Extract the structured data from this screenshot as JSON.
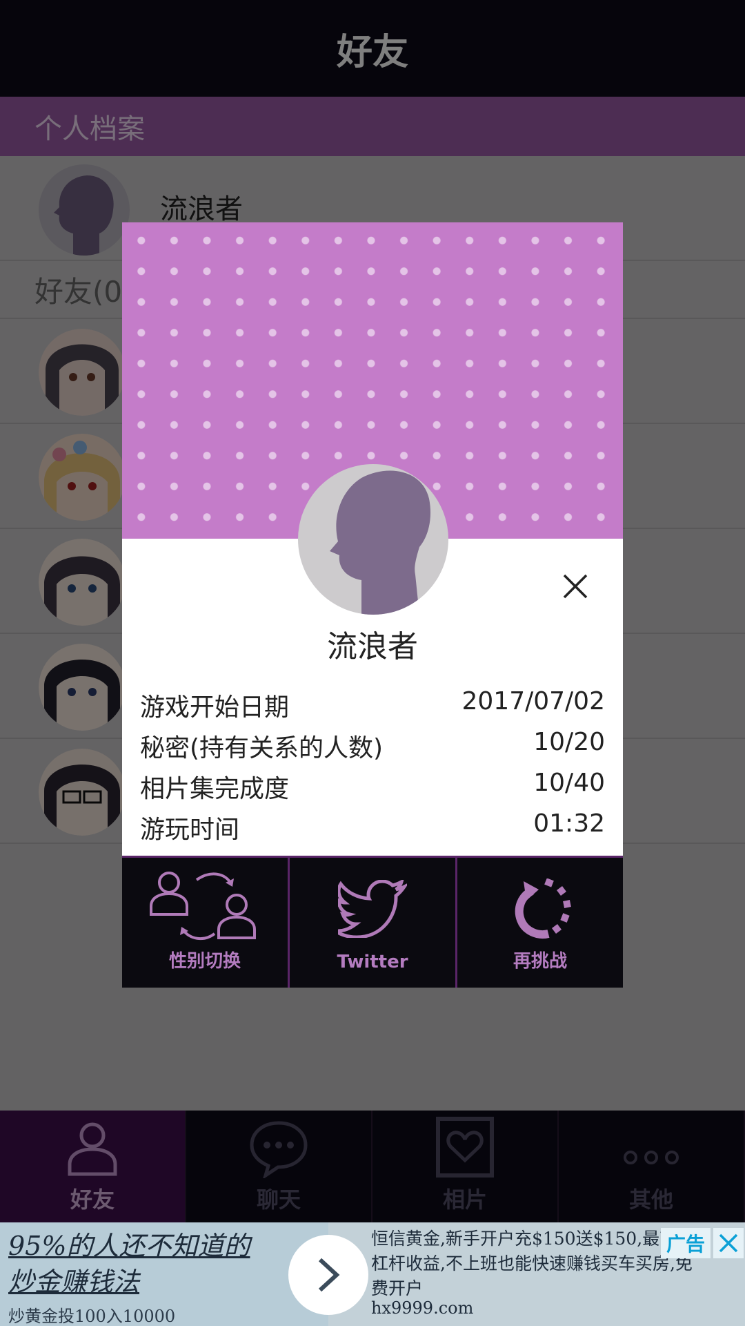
{
  "app": {
    "title": "好友",
    "profile_section_label": "个人档案",
    "profile_name": "流浪者",
    "friends_header": "好友(0"
  },
  "tabs": [
    {
      "label": "好友",
      "icon": "person-icon",
      "active": true
    },
    {
      "label": "聊天",
      "icon": "chat-bubble-icon",
      "active": false
    },
    {
      "label": "相片",
      "icon": "photo-heart-icon",
      "active": false
    },
    {
      "label": "其他",
      "icon": "more-dots-icon",
      "active": false
    }
  ],
  "modal": {
    "name": "流浪者",
    "stats": [
      {
        "label": "游戏开始日期",
        "value": "2017/07/02"
      },
      {
        "label": "秘密(持有关系的人数)",
        "value": "10/20"
      },
      {
        "label": "相片集完成度",
        "value": "10/40"
      },
      {
        "label": "游玩时间",
        "value": "01:32"
      }
    ],
    "actions": [
      {
        "label": "性别切换",
        "icon": "gender-switch-icon"
      },
      {
        "label": "Twitter",
        "icon": "twitter-bird-icon"
      },
      {
        "label": "再挑战",
        "icon": "retry-loading-icon"
      }
    ]
  },
  "ad": {
    "left_title_line1": "95%的人还不知道的",
    "left_title_line2": "炒金赚钱法",
    "left_sub": "炒黄金投100入10000",
    "right_text": "恒信黄金,新手开户充$150送$150,最高倍杠杆收益,不上班也能快速赚钱买车买房,免费开户",
    "right_url": "hx9999.com",
    "tag": "广告"
  },
  "colors": {
    "accent_purple": "#c47cc9",
    "dark_header": "#0d0a18",
    "tab_active": "#3f0f4d"
  }
}
